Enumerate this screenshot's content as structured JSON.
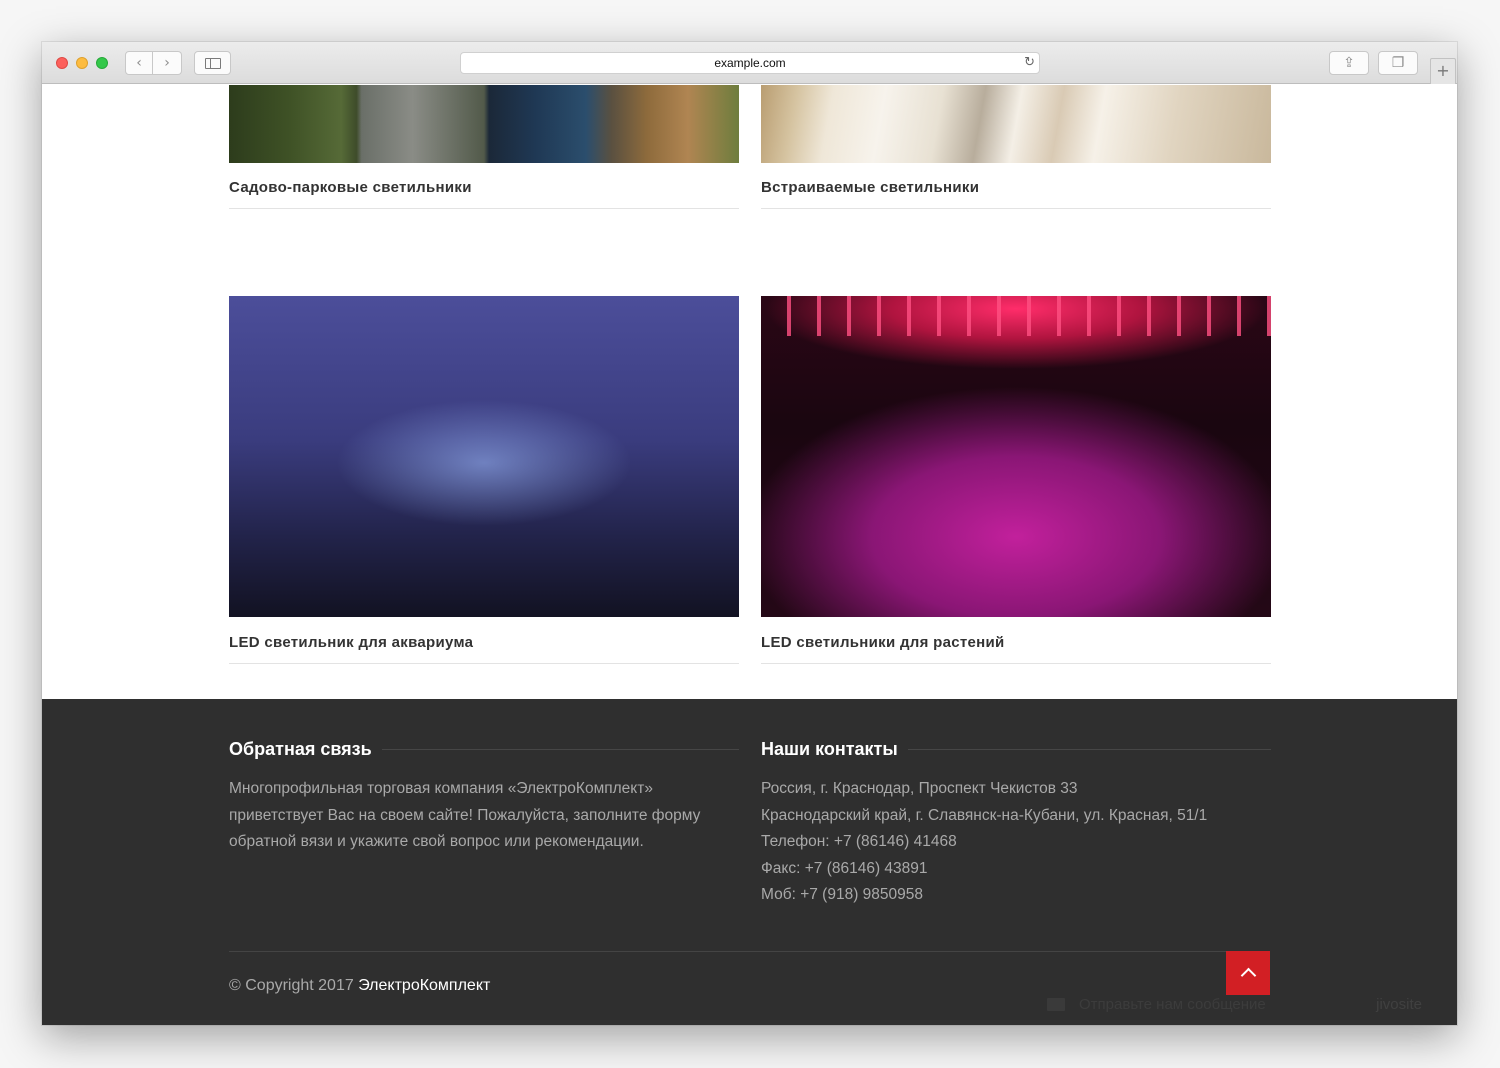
{
  "browser": {
    "url": "example.com",
    "new_tab": "+"
  },
  "products": [
    {
      "title": "Садово-парковые светильники"
    },
    {
      "title": "Встраиваемые светильники"
    },
    {
      "title": "LED светильник для аквариума"
    },
    {
      "title": "LED светильники для растений"
    }
  ],
  "footer": {
    "feedback": {
      "heading": "Обратная связь",
      "text": "Многопрофильная торговая компания «ЭлектроКомплект» приветствует Вас на своем сайте! Пожалуйста, заполните форму обратной вязи и укажите свой вопрос или рекомендации."
    },
    "contacts": {
      "heading": "Наши контакты",
      "lines": [
        "Россия, г. Краснодар, Проспект Чекистов 33",
        "Краснодарский край, г. Славянск-на-Кубани, ул. Красная, 51/1",
        "Телефон: +7 (86146) 41468",
        "Факс: +7 (86146) 43891",
        "Моб: +7 (918) 9850958"
      ]
    },
    "copyright_prefix": "© Copyright 2017 ",
    "copyright_brand": "ЭлектроКомплект",
    "chat_label": "Отправьте нам сообщение",
    "chat_brand": "jivosite"
  },
  "colors": {
    "accent": "#d21f24",
    "footer_bg": "#2f2f2f"
  }
}
